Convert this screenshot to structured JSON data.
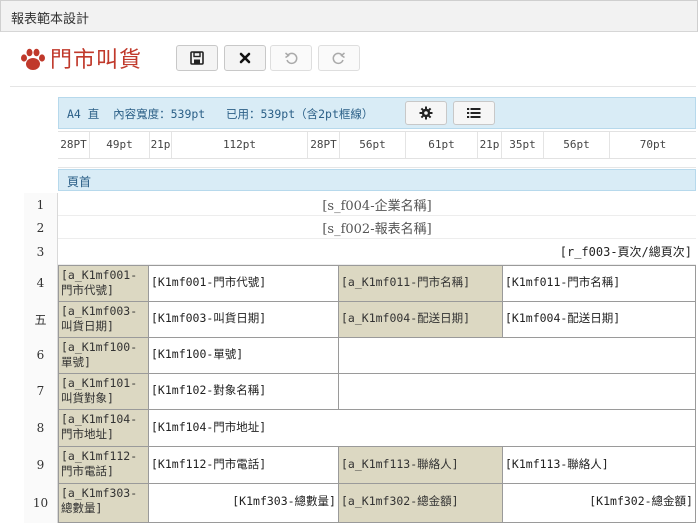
{
  "window": {
    "title": "報表範本設計"
  },
  "header": {
    "page_title": "門市叫貨"
  },
  "toolbar": {
    "save_icon": "save-icon",
    "close_icon": "close-icon",
    "undo_icon": "undo-icon",
    "redo_icon": "redo-icon"
  },
  "info_bar": {
    "text": "A4 直  內容寬度：539pt   已用：539pt（含2pt框線）",
    "settings_icon": "gear-icon",
    "list_icon": "list-icon"
  },
  "column_widths": [
    "28PT",
    "49pt",
    "21p",
    "112pt",
    "28PT",
    "56pt",
    "61pt",
    "21p",
    "35pt",
    "56pt",
    "70pt"
  ],
  "section": {
    "label": "頁首"
  },
  "rows": [
    {
      "num": "1",
      "text": "[s_f004-企業名稱]"
    },
    {
      "num": "2",
      "text": "[s_f002-報表名稱]"
    },
    {
      "num": "3",
      "text": "[r_f003-頁次/總頁次]"
    },
    {
      "num": "4",
      "c1": "[a_K1mf001-門市代號]",
      "c2": "[K1mf001-門市代號]",
      "c3": "[a_K1mf011-門市名稱]",
      "c4": "[K1mf011-門市名稱]"
    },
    {
      "num": "五",
      "c1": "[a_K1mf003-叫貨日期]",
      "c2": "[K1mf003-叫貨日期]",
      "c3": "[a_K1mf004-配送日期]",
      "c4": "[K1mf004-配送日期]"
    },
    {
      "num": "6",
      "c1": "[a_K1mf100-單號]",
      "c2": "[K1mf100-單號]"
    },
    {
      "num": "7",
      "c1": "[a_K1mf101-叫貨對象]",
      "c2": "[K1mf102-對象名稱]"
    },
    {
      "num": "8",
      "c1": "[a_K1mf104-門市地址]",
      "c2": "[K1mf104-門市地址]"
    },
    {
      "num": "9",
      "c1": "[a_K1mf112-門市電話]",
      "c2": "[K1mf112-門市電話]",
      "c3": "[a_K1mf113-聯絡人]",
      "c4": "[K1mf113-聯絡人]"
    },
    {
      "num": "10",
      "c1": "[a_K1mf303-總數量]",
      "c2": "[K1mf303-總數量]",
      "c3": "[a_K1mf302-總金額]",
      "c4": "[K1mf302-總金額]"
    }
  ],
  "colors": {
    "brand": "#c0392b",
    "info_bg": "#d9ecf6",
    "label_bg": "#dcd8c2"
  }
}
